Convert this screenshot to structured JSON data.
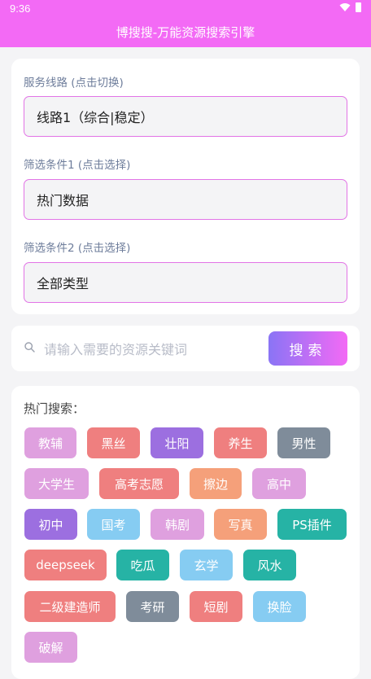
{
  "status_bar": {
    "time": "9:36"
  },
  "header": {
    "title": "博搜搜-万能资源搜索引擎"
  },
  "settings": {
    "route": {
      "label": "服务线路 (点击切换)",
      "value": "线路1（综合|稳定）"
    },
    "filter1": {
      "label": "筛选条件1 (点击选择)",
      "value": "热门数据"
    },
    "filter2": {
      "label": "筛选条件2 (点击选择)",
      "value": "全部类型"
    }
  },
  "search": {
    "placeholder": "请输入需要的资源关键词",
    "button": "搜索"
  },
  "hot": {
    "title": "热门搜索：",
    "tags": [
      {
        "text": "教辅",
        "color": "#dfa0df"
      },
      {
        "text": "黑丝",
        "color": "#ef7f7f"
      },
      {
        "text": "壮阳",
        "color": "#9c6fe0"
      },
      {
        "text": "养生",
        "color": "#ef7f7f"
      },
      {
        "text": "男性",
        "color": "#7f8c9a"
      },
      {
        "text": "大学生",
        "color": "#dfa0df"
      },
      {
        "text": "高考志愿",
        "color": "#ef7f7f"
      },
      {
        "text": "擦边",
        "color": "#f5a07a"
      },
      {
        "text": "高中",
        "color": "#dfa0df"
      },
      {
        "text": "初中",
        "color": "#9c6fe0"
      },
      {
        "text": "国考",
        "color": "#86ccf2"
      },
      {
        "text": "韩剧",
        "color": "#dfa0df"
      },
      {
        "text": "写真",
        "color": "#f5a07a"
      },
      {
        "text": "PS插件",
        "color": "#26b3a5"
      },
      {
        "text": "deepseek",
        "color": "#ef7f7f"
      },
      {
        "text": "吃瓜",
        "color": "#26b3a5"
      },
      {
        "text": "玄学",
        "color": "#86ccf2"
      },
      {
        "text": "风水",
        "color": "#26b3a5"
      },
      {
        "text": "二级建造师",
        "color": "#ef7f7f"
      },
      {
        "text": "考研",
        "color": "#7f8c9a"
      },
      {
        "text": "短剧",
        "color": "#ef7f7f"
      },
      {
        "text": "换脸",
        "color": "#86ccf2"
      },
      {
        "text": "破解",
        "color": "#dfa0df"
      }
    ]
  }
}
